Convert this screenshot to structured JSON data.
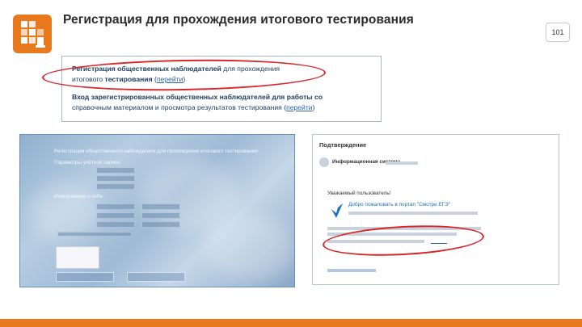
{
  "header": {
    "title": "Регистрация для прохождения итогового тестирования",
    "page_number": "101"
  },
  "colors": {
    "accent": "#e8791f",
    "highlight": "#d9262a",
    "link": "#2b5fb0"
  },
  "top_panel": {
    "line1_prefix": "Регистрация общественных наблюдателей",
    "line1_suffix": " для прохождения",
    "line2_prefix": "итогового ",
    "line2_bold": "тестирования",
    "line2_open": " (",
    "line2_link": "перейти",
    "line2_close": ")",
    "line3": "Вход зарегистрированных общественных наблюдателей для работы со",
    "line4_prefix": "справочным материалом и просмотра результатов тестирования (",
    "line4_link": "перейти",
    "line4_close": ")"
  },
  "form_panel": {
    "title": "Регистрация общественного наблюдателя для прохождения итогового тестирования",
    "section_account": "Параметры учётной записи",
    "section_info": "Информация о себе"
  },
  "email_panel": {
    "title": "Подтверждение",
    "sender": "Информационная система",
    "salutation": "Уважаемый пользователь!",
    "welcome": "Добро пожаловать в портал \"Смотри ЕГЭ\""
  }
}
